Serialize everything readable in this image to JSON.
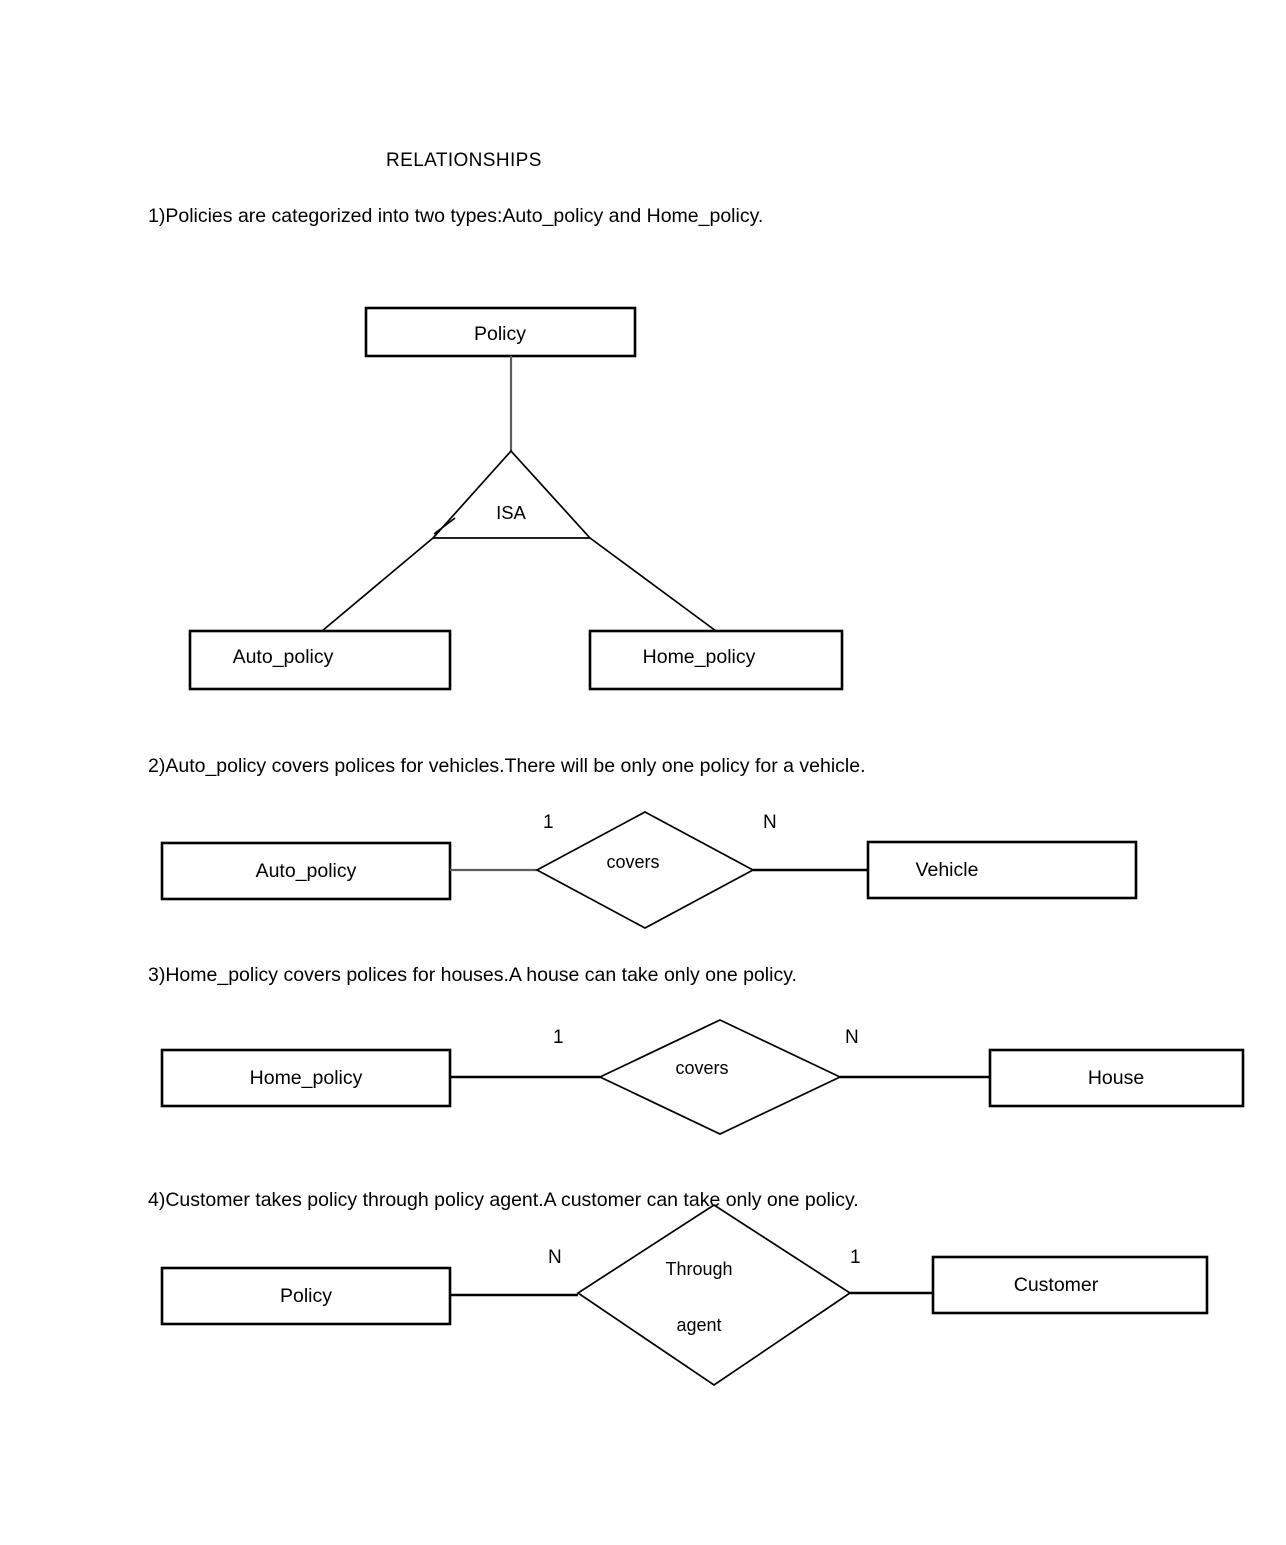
{
  "document": {
    "heading": "RELATIONSHIPS",
    "sections": [
      {
        "caption": "1)Policies are categorized into two types:Auto_policy and Home_policy.",
        "diagram": {
          "kind": "isa-hierarchy",
          "parent": "Policy",
          "relationship": "ISA",
          "children": [
            "Auto_policy",
            "Home_policy"
          ]
        }
      },
      {
        "caption": "2)Auto_policy covers polices for vehicles.There will be only one policy for a vehicle.",
        "diagram": {
          "kind": "binary-relationship",
          "left_entity": "Auto_policy",
          "left_cardinality": "1",
          "relationship": "covers",
          "right_cardinality": "N",
          "right_entity": "Vehicle"
        }
      },
      {
        "caption": "3)Home_policy covers polices for houses.A house can take only one policy.",
        "diagram": {
          "kind": "binary-relationship",
          "left_entity": "Home_policy",
          "left_cardinality": "1",
          "relationship": "covers",
          "right_cardinality": "N",
          "right_entity": "House"
        }
      },
      {
        "caption": "4)Customer takes policy through policy agent.A customer can take only one policy.",
        "diagram": {
          "kind": "binary-relationship",
          "left_entity": "Policy",
          "left_cardinality": "N",
          "relationship_line1": "Through",
          "relationship_line2": "agent",
          "right_cardinality": "1",
          "right_entity": "Customer"
        }
      }
    ]
  },
  "colors": {
    "page_background": "#ffffff",
    "ink": "#000000",
    "faint_line": "#5d5d5d"
  }
}
